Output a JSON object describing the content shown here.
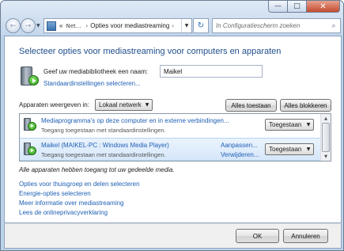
{
  "window": {
    "minimize_glyph": "—",
    "maximize_glyph": "□",
    "close_glyph": "✕"
  },
  "nav": {
    "back_glyph": "←",
    "forward_glyph": "→",
    "history_glyph": "▼",
    "breadcrumb": [
      "«",
      "Net...",
      "›",
      "Opties voor mediastreaming",
      "›"
    ],
    "address_dropdown_glyph": "▼",
    "refresh_glyph": "↻",
    "search_placeholder": "In Configuratiescherm zoeken",
    "search_glyph": "⌕"
  },
  "main": {
    "title": "Selecteer opties voor mediastreaming voor computers en apparaten",
    "library_label": "Geef uw mediabibliotheek een naam:",
    "library_value": "Maikel",
    "default_settings_link": "Standaardinstellingen selecteren...",
    "show_devices_label": "Apparaten weergeven in:",
    "network_select": "Lokaal netwerk",
    "allow_all": "Alles toestaan",
    "block_all": "Alles blokkeren",
    "devices": [
      {
        "name": "Mediaprogramma's op deze computer en in externe verbindingen...",
        "subtitle": "Toegang toegestaan met standaardinstellingen.",
        "status": "Toegestaan"
      },
      {
        "name": "Maikel (MAIKEL-PC : Windows Media Player)",
        "subtitle": "Toegang toegestaan met standaardinstellingen.",
        "customize": "Aanpassen...",
        "remove": "Verwijderen...",
        "status": "Toegestaan"
      }
    ],
    "note": "Alle apparaten hebben toegang tot uw gedeelde media.",
    "links": [
      "Opties voor thuisgroep en delen selecteren",
      "Energie-opties selecteren",
      "Meer informatie over mediastreaming",
      "Lees de onlineprivacyverklaring"
    ]
  },
  "footer": {
    "ok": "OK",
    "cancel": "Annuleren"
  },
  "colors": {
    "title_blue": "#1f4e8d",
    "link_blue": "#1f5fb4",
    "selection": "#d6e7fa"
  }
}
